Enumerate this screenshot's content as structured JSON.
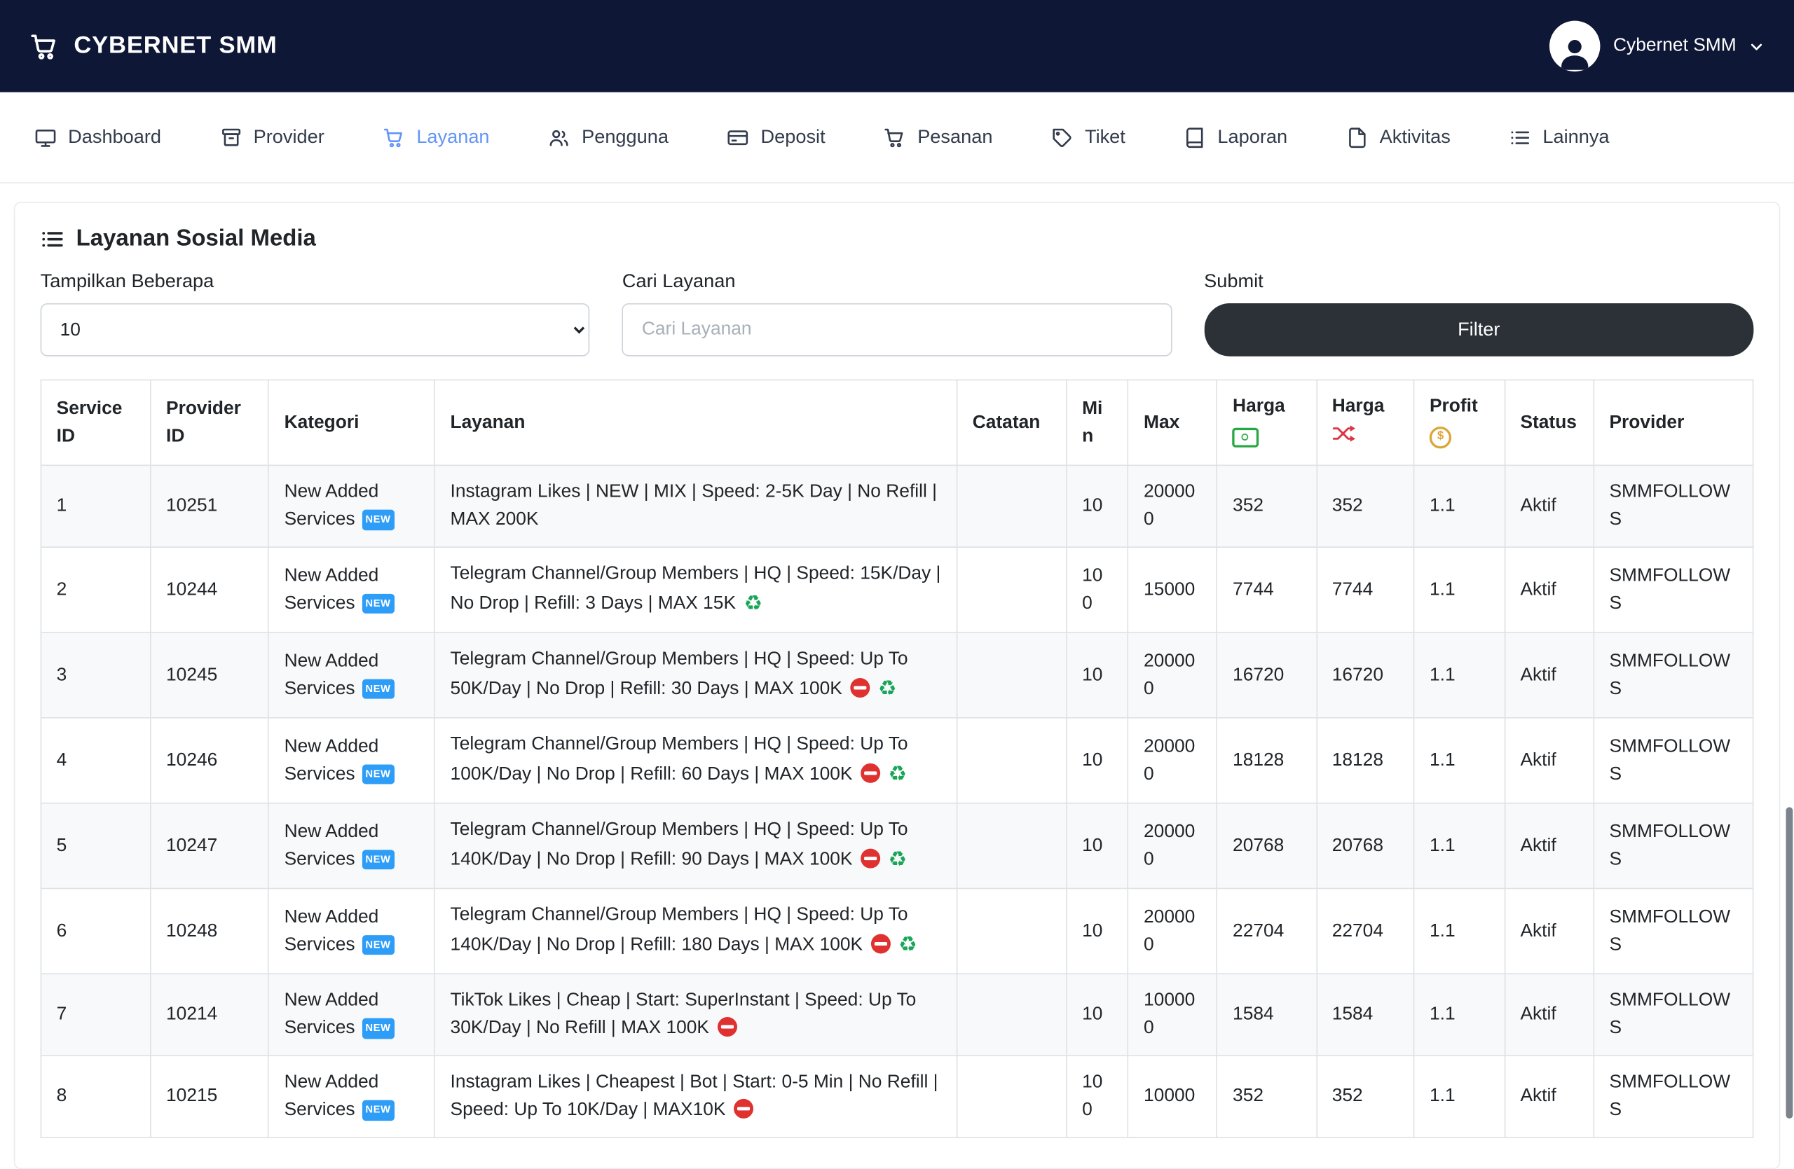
{
  "header": {
    "brand": "CYBERNET SMM",
    "user": "Cybernet SMM"
  },
  "nav": {
    "items": [
      {
        "label": "Dashboard",
        "icon": "monitor-icon",
        "active": false
      },
      {
        "label": "Provider",
        "icon": "server-icon",
        "active": false
      },
      {
        "label": "Layanan",
        "icon": "cart-icon",
        "active": true
      },
      {
        "label": "Pengguna",
        "icon": "users-icon",
        "active": false
      },
      {
        "label": "Deposit",
        "icon": "credit-card-icon",
        "active": false
      },
      {
        "label": "Pesanan",
        "icon": "cart-icon",
        "active": false
      },
      {
        "label": "Tiket",
        "icon": "tag-icon",
        "active": false
      },
      {
        "label": "Laporan",
        "icon": "book-icon",
        "active": false
      },
      {
        "label": "Aktivitas",
        "icon": "file-icon",
        "active": false
      },
      {
        "label": "Lainnya",
        "icon": "list-icon",
        "active": false
      }
    ]
  },
  "page": {
    "title": "Layanan Sosial Media",
    "controls": {
      "show_label": "Tampilkan Beberapa",
      "show_value": "10",
      "search_label": "Cari Layanan",
      "search_placeholder": "Cari Layanan",
      "search_value": "",
      "submit_label": "Submit",
      "filter_button": "Filter"
    },
    "table": {
      "headers": [
        "Service ID",
        "Provider ID",
        "Kategori",
        "Layanan",
        "Catatan",
        "Min",
        "Max",
        "Harga",
        "Harga",
        "Profit",
        "Status",
        "Provider"
      ],
      "rows": [
        {
          "service_id": "1",
          "provider_id": "10251",
          "kategori": "New Added Services",
          "kategori_badge": "NEW",
          "layanan": "Instagram Likes | NEW | MIX | Speed: 2-5K Day | No Refill | MAX 200K",
          "badges": [],
          "catatan": "",
          "min": "10",
          "max": "200000",
          "harga_beli": "352",
          "harga_jual": "352",
          "profit": "1.1",
          "status": "Aktif",
          "provider": "SMMFOLLOWS"
        },
        {
          "service_id": "2",
          "provider_id": "10244",
          "kategori": "New Added Services",
          "kategori_badge": "NEW",
          "layanan": "Telegram Channel/Group Members | HQ | Speed: 15K/Day | No Drop | Refill: 3 Days | MAX 15K",
          "badges": [
            "recycle"
          ],
          "catatan": "",
          "min": "100",
          "max": "15000",
          "harga_beli": "7744",
          "harga_jual": "7744",
          "profit": "1.1",
          "status": "Aktif",
          "provider": "SMMFOLLOWS"
        },
        {
          "service_id": "3",
          "provider_id": "10245",
          "kategori": "New Added Services",
          "kategori_badge": "NEW",
          "layanan": "Telegram Channel/Group Members | HQ | Speed: Up To 50K/Day | No Drop | Refill: 30 Days | MAX 100K",
          "badges": [
            "no-entry",
            "recycle"
          ],
          "catatan": "",
          "min": "10",
          "max": "200000",
          "harga_beli": "16720",
          "harga_jual": "16720",
          "profit": "1.1",
          "status": "Aktif",
          "provider": "SMMFOLLOWS"
        },
        {
          "service_id": "4",
          "provider_id": "10246",
          "kategori": "New Added Services",
          "kategori_badge": "NEW",
          "layanan": "Telegram Channel/Group Members | HQ | Speed: Up To 100K/Day | No Drop | Refill: 60 Days | MAX 100K",
          "badges": [
            "no-entry",
            "recycle"
          ],
          "catatan": "",
          "min": "10",
          "max": "200000",
          "harga_beli": "18128",
          "harga_jual": "18128",
          "profit": "1.1",
          "status": "Aktif",
          "provider": "SMMFOLLOWS"
        },
        {
          "service_id": "5",
          "provider_id": "10247",
          "kategori": "New Added Services",
          "kategori_badge": "NEW",
          "layanan": "Telegram Channel/Group Members | HQ | Speed: Up To 140K/Day | No Drop | Refill: 90 Days | MAX 100K",
          "badges": [
            "no-entry",
            "recycle"
          ],
          "catatan": "",
          "min": "10",
          "max": "200000",
          "harga_beli": "20768",
          "harga_jual": "20768",
          "profit": "1.1",
          "status": "Aktif",
          "provider": "SMMFOLLOWS"
        },
        {
          "service_id": "6",
          "provider_id": "10248",
          "kategori": "New Added Services",
          "kategori_badge": "NEW",
          "layanan": "Telegram Channel/Group Members | HQ | Speed: Up To 140K/Day | No Drop | Refill: 180 Days | MAX 100K",
          "badges": [
            "no-entry",
            "recycle"
          ],
          "catatan": "",
          "min": "10",
          "max": "200000",
          "harga_beli": "22704",
          "harga_jual": "22704",
          "profit": "1.1",
          "status": "Aktif",
          "provider": "SMMFOLLOWS"
        },
        {
          "service_id": "7",
          "provider_id": "10214",
          "kategori": "New Added Services",
          "kategori_badge": "NEW",
          "layanan": "TikTok Likes | Cheap | Start: SuperInstant | Speed: Up To 30K/Day | No Refill | MAX 100K",
          "badges": [
            "no-entry"
          ],
          "catatan": "",
          "min": "10",
          "max": "100000",
          "harga_beli": "1584",
          "harga_jual": "1584",
          "profit": "1.1",
          "status": "Aktif",
          "provider": "SMMFOLLOWS"
        },
        {
          "service_id": "8",
          "provider_id": "10215",
          "kategori": "New Added Services",
          "kategori_badge": "NEW",
          "layanan": "Instagram Likes | Cheapest | Bot | Start: 0-5 Min | No Refill | Speed: Up To 10K/Day | MAX10K",
          "badges": [
            "no-entry"
          ],
          "catatan": "",
          "min": "100",
          "max": "10000",
          "harga_beli": "352",
          "harga_jual": "352",
          "profit": "1.1",
          "status": "Aktif",
          "provider": "SMMFOLLOWS"
        }
      ]
    }
  },
  "icons": {
    "coin_symbol": "$",
    "recycle_symbol": "♻"
  },
  "colors": {
    "header_bg": "#0e1736",
    "nav_active": "#6295f6",
    "filter_button": "#2b3137",
    "badge_new": "#2e9df7",
    "no_entry": "#e03131",
    "recycle": "#18a558",
    "harga_green": "#28a745",
    "harga_red": "#dc3545",
    "coin": "#dba635"
  }
}
